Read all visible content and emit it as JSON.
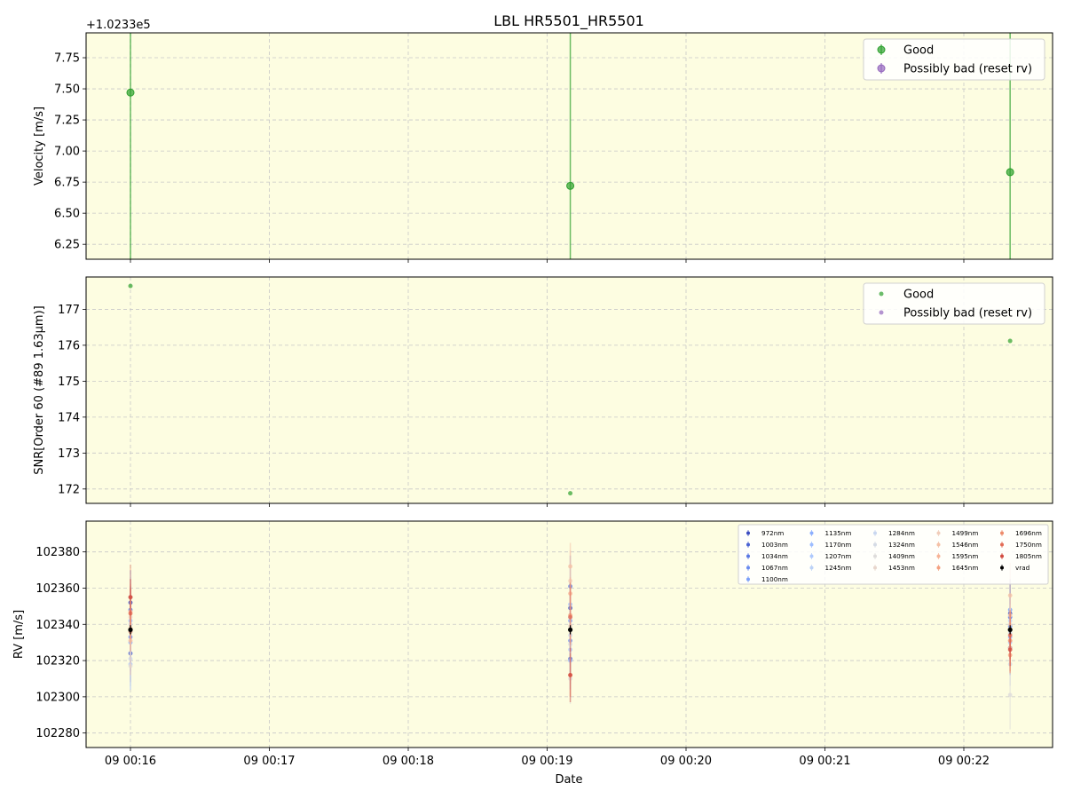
{
  "title": "LBL HR5501_HR5501",
  "xlabel": "Date",
  "x_ticks": [
    "09 00:16",
    "09 00:17",
    "09 00:18",
    "09 00:19",
    "09 00:20",
    "09 00:21",
    "09 00:22"
  ],
  "colors": {
    "panel_bg": "#fdfde1",
    "good": "#2ca02c",
    "bad": "#9467bd",
    "vrad": "#000000"
  },
  "chart_data": [
    {
      "type": "scatter",
      "name": "velocity",
      "ylabel": "Velocity [m/s]",
      "offset_text": "+1.0233e5",
      "y_ticks": [
        "6.25",
        "6.50",
        "6.75",
        "7.00",
        "7.25",
        "7.50",
        "7.75"
      ],
      "ylim": [
        6.13,
        7.95
      ],
      "grid": true,
      "legend": {
        "placement": "top-right",
        "entries": [
          "Good",
          "Possibly bad (reset rv)"
        ]
      },
      "series": [
        {
          "name": "Good",
          "points": [
            {
              "x": "09 00:16:00",
              "y": 7.47
            },
            {
              "x": "09 00:19:10",
              "y": 6.72
            },
            {
              "x": "09 00:22:20",
              "y": 6.83
            }
          ]
        },
        {
          "name": "Possibly bad (reset rv)",
          "points": []
        }
      ]
    },
    {
      "type": "scatter",
      "name": "snr",
      "ylabel": "SNR[Order 60 (#89 1.63μm)]",
      "y_ticks": [
        "172",
        "173",
        "174",
        "175",
        "176",
        "177"
      ],
      "ylim": [
        171.6,
        177.9
      ],
      "grid": true,
      "legend": {
        "placement": "top-right",
        "entries": [
          "Good",
          "Possibly bad (reset rv)"
        ]
      },
      "series": [
        {
          "name": "Good",
          "points": [
            {
              "x": "09 00:16:00",
              "y": 177.65
            },
            {
              "x": "09 00:19:10",
              "y": 171.88
            },
            {
              "x": "09 00:22:20",
              "y": 176.12
            }
          ]
        },
        {
          "name": "Possibly bad (reset rv)",
          "points": []
        }
      ]
    },
    {
      "type": "scatter",
      "name": "rv",
      "ylabel": "RV [m/s]",
      "y_ticks": [
        "102280",
        "102300",
        "102320",
        "102340",
        "102360",
        "102380"
      ],
      "ylim": [
        102272,
        102397
      ],
      "grid": true,
      "legend": {
        "placement": "top-right",
        "columns": 5
      },
      "times": [
        "09 00:16:00",
        "09 00:19:10",
        "09 00:22:20"
      ],
      "series": [
        {
          "name": "972nm",
          "color": "#3b4cc0",
          "values": [
            102352,
            102349,
            102346
          ]
        },
        {
          "name": "1003nm",
          "color": "#4a63d3",
          "values": [
            102324,
            102321,
            102327
          ]
        },
        {
          "name": "1034nm",
          "color": "#5a78e4",
          "values": [
            102348,
            102361,
            102344
          ]
        },
        {
          "name": "1067nm",
          "color": "#6a8bef",
          "values": [
            102333,
            102331,
            102339
          ]
        },
        {
          "name": "1100nm",
          "color": "#7b9ff9",
          "values": [
            102355,
            102342,
            102348
          ]
        },
        {
          "name": "1135nm",
          "color": "#8caffe",
          "values": [
            102330,
            102320,
            102333
          ]
        },
        {
          "name": "1170nm",
          "color": "#9dbdff",
          "values": [
            102342,
            102351,
            102337
          ]
        },
        {
          "name": "1207nm",
          "color": "#aec9fd",
          "values": [
            102318,
            102326,
            102330
          ]
        },
        {
          "name": "1245nm",
          "color": "#bcd2f7",
          "values": [
            102336,
            102344,
            102342
          ]
        },
        {
          "name": "1284nm",
          "color": "#c9d7f0",
          "values": [
            102321,
            102334,
            102335
          ]
        },
        {
          "name": "1324nm",
          "color": "#d5dbe5",
          "values": [
            102340,
            102329,
            102318
          ]
        },
        {
          "name": "1409nm",
          "color": "#dedcdb",
          "values": [
            102317,
            102310,
            102301
          ]
        },
        {
          "name": "1453nm",
          "color": "#e8d6cc",
          "values": [
            102344,
            102339,
            102340
          ]
        },
        {
          "name": "1499nm",
          "color": "#f1cdba",
          "values": [
            102338,
            102364,
            102345
          ]
        },
        {
          "name": "1546nm",
          "color": "#f5c0a5",
          "values": [
            102331,
            102372,
            102356
          ]
        },
        {
          "name": "1595nm",
          "color": "#f7b396",
          "values": [
            102347,
            102357,
            102327
          ]
        },
        {
          "name": "1645nm",
          "color": "#f4a080",
          "values": [
            102336,
            102345,
            102323
          ]
        },
        {
          "name": "1696nm",
          "color": "#ed8b6a",
          "values": [
            102355,
            102312,
            102331
          ]
        },
        {
          "name": "1750nm",
          "color": "#e36c55",
          "values": [
            102346,
            102344,
            102334
          ]
        },
        {
          "name": "1805nm",
          "color": "#d24b40",
          "values": [
            102355,
            102312,
            102326
          ]
        },
        {
          "name": "vrad",
          "color": "#000000",
          "values": [
            102337,
            102337,
            102337
          ]
        }
      ]
    }
  ]
}
